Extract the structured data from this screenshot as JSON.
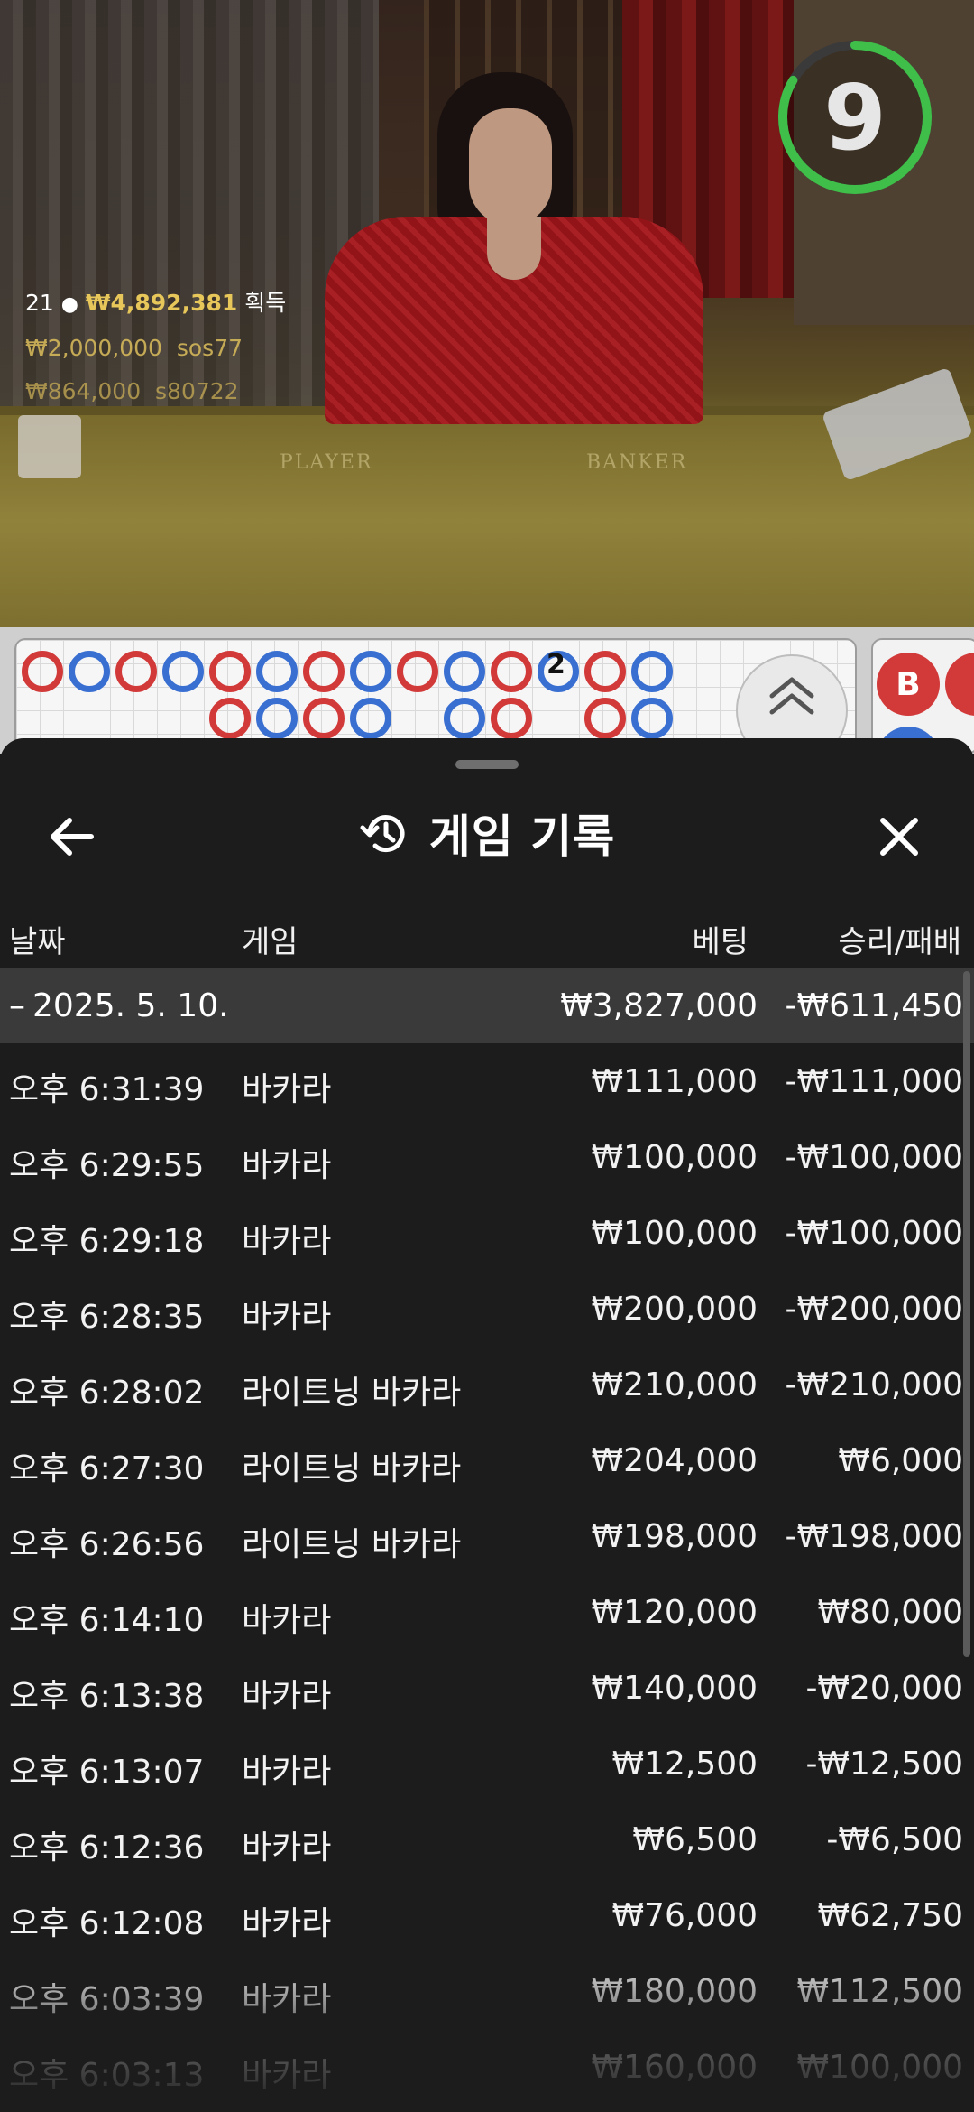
{
  "video": {
    "timer_value": "9",
    "timer_color": "#3fbf4a",
    "felt_player_label": "PLAYER",
    "felt_banker_label": "BANKER"
  },
  "overlay": {
    "players_count": "21",
    "total_win": "₩4,892,381",
    "total_win_suffix": "획득",
    "bets": [
      {
        "amount": "₩2,000,000",
        "user": "sos77"
      },
      {
        "amount": "₩864,000",
        "user": "s80722"
      }
    ]
  },
  "road": {
    "marker_number": "2",
    "side_label": "B"
  },
  "sheet": {
    "title": "게임 기록",
    "back_icon": "arrow-left-icon",
    "history_icon": "history-icon",
    "close_icon": "close-icon"
  },
  "columns": {
    "date": "날짜",
    "game": "게임",
    "bet": "베팅",
    "result": "승리/패배"
  },
  "group": {
    "date": "2025. 5. 10.",
    "bet": "₩3,827,000",
    "result": "-₩611,450"
  },
  "rows": [
    {
      "time": "오후 6:31:39",
      "game": "바카라",
      "bet": "₩111,000",
      "result": "-₩111,000"
    },
    {
      "time": "오후 6:29:55",
      "game": "바카라",
      "bet": "₩100,000",
      "result": "-₩100,000"
    },
    {
      "time": "오후 6:29:18",
      "game": "바카라",
      "bet": "₩100,000",
      "result": "-₩100,000"
    },
    {
      "time": "오후 6:28:35",
      "game": "바카라",
      "bet": "₩200,000",
      "result": "-₩200,000"
    },
    {
      "time": "오후 6:28:02",
      "game": "라이트닝 바카라",
      "bet": "₩210,000",
      "result": "-₩210,000"
    },
    {
      "time": "오후 6:27:30",
      "game": "라이트닝 바카라",
      "bet": "₩204,000",
      "result": "₩6,000"
    },
    {
      "time": "오후 6:26:56",
      "game": "라이트닝 바카라",
      "bet": "₩198,000",
      "result": "-₩198,000"
    },
    {
      "time": "오후 6:14:10",
      "game": "바카라",
      "bet": "₩120,000",
      "result": "₩80,000"
    },
    {
      "time": "오후 6:13:38",
      "game": "바카라",
      "bet": "₩140,000",
      "result": "-₩20,000"
    },
    {
      "time": "오후 6:13:07",
      "game": "바카라",
      "bet": "₩12,500",
      "result": "-₩12,500"
    },
    {
      "time": "오후 6:12:36",
      "game": "바카라",
      "bet": "₩6,500",
      "result": "-₩6,500"
    },
    {
      "time": "오후 6:12:08",
      "game": "바카라",
      "bet": "₩76,000",
      "result": "₩62,750"
    },
    {
      "time": "오후 6:03:39",
      "game": "바카라",
      "bet": "₩180,000",
      "result": "₩112,500"
    },
    {
      "time": "오후 6:03:13",
      "game": "바카라",
      "bet": "₩160,000",
      "result": "₩100,000"
    }
  ]
}
